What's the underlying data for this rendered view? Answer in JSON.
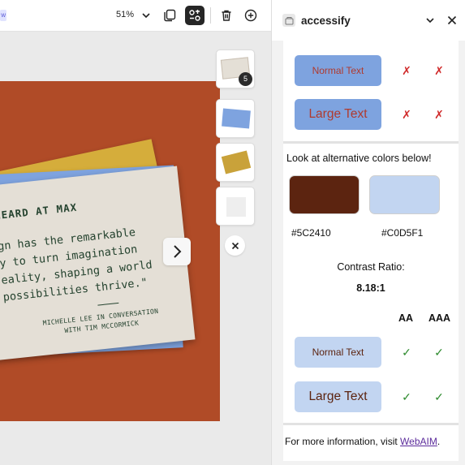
{
  "toolbar": {
    "chip_text": "w",
    "zoom": "51%",
    "icons": [
      "duplicate-page-icon",
      "arrange-icon",
      "trash-icon",
      "add-page-icon"
    ]
  },
  "card": {
    "heading": "HEARD AT MAX",
    "quote": "gn has the remarkable\ny to turn imagination\neality, shaping a world\npossibilities thrive.\"",
    "attribution": "MICHELLE LEE IN CONVERSATION\nWITH TIM MCCORMICK"
  },
  "thumbnails": {
    "badge": "5"
  },
  "panel": {
    "title": "accessify",
    "current": {
      "normal_label": "Normal Text",
      "large_label": "Large Text",
      "fail_mark": "✗"
    },
    "alt_label": "Look at alternative colors below!",
    "swatches": [
      {
        "hex": "#5C2410",
        "color": "#5c2410"
      },
      {
        "hex": "#C0D5F1",
        "color": "#c2d5f1"
      }
    ],
    "contrast_label": "Contrast Ratio:",
    "contrast_value": "8.18:1",
    "col_aa": "AA",
    "col_aaa": "AAA",
    "alternative": {
      "normal_label": "Normal Text",
      "large_label": "Large Text",
      "pass_mark": "✓"
    },
    "footer_text": "For more information, visit ",
    "footer_link": "WebAIM",
    "footer_end": "."
  },
  "colors": {
    "artboard": "#b04b27",
    "accent_blue": "#7ea3df",
    "fail": "#d02a2a",
    "pass": "#2e8b2e"
  }
}
